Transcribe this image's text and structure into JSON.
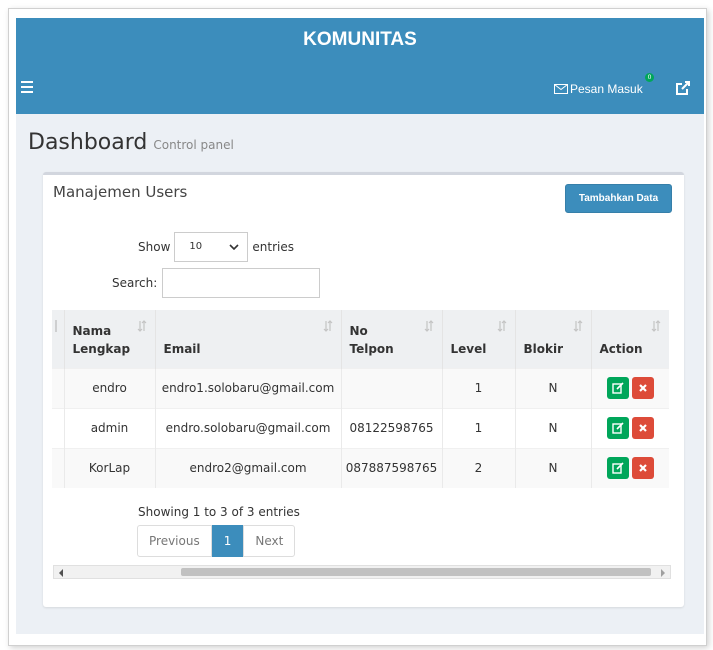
{
  "header": {
    "title": "KOMUNITAS"
  },
  "navbar": {
    "menu_icon": "hamburger-icon",
    "inbox_label": "Pesan Masuk",
    "inbox_icon": "envelope-icon",
    "inbox_count": "0",
    "external_icon": "external-link-icon"
  },
  "page": {
    "title": "Dashboard",
    "subtitle": "Control panel"
  },
  "users_box": {
    "title": "Manajemen Users",
    "add_button": "Tambahkan Data",
    "show_label": "Show",
    "entries_value": "10",
    "entries_label": "entries",
    "search_label": "Search:",
    "search_value": "",
    "columns": [
      "Nama Lengkap",
      "Email",
      "No Telpon",
      "Level",
      "Blokir",
      "Action"
    ],
    "rows": [
      {
        "nama": "endro",
        "email": "endro1.solobaru@gmail.com",
        "telpon": "",
        "level": "1",
        "blokir": "N"
      },
      {
        "nama": "admin",
        "email": "endro.solobaru@gmail.com",
        "telpon": "08122598765",
        "level": "1",
        "blokir": "N"
      },
      {
        "nama": "KorLap",
        "email": "endro2@gmail.com",
        "telpon": "087887598765",
        "level": "2",
        "blokir": "N"
      }
    ],
    "info": "Showing 1 to 3 of 3 entries",
    "pagination": {
      "previous": "Previous",
      "current": "1",
      "next": "Next"
    }
  },
  "colors": {
    "primary": "#3c8dbc",
    "success": "#00a65a",
    "danger": "#dd4b39",
    "background": "#ecf0f5"
  }
}
